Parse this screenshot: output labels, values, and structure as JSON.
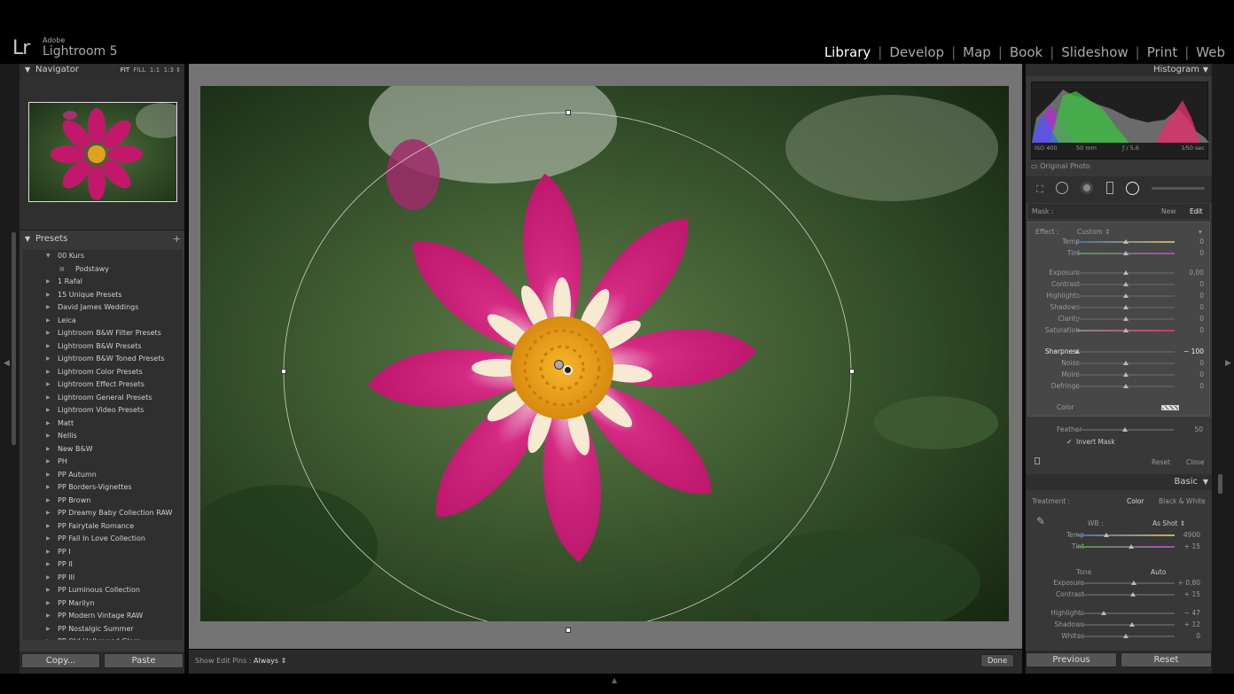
{
  "app": {
    "logo": "Lr",
    "vendor": "Adobe",
    "name": "Lightroom 5"
  },
  "modules": [
    "Library",
    "Develop",
    "Map",
    "Book",
    "Slideshow",
    "Print",
    "Web"
  ],
  "active_module": "Library",
  "navigator": {
    "title": "Navigator",
    "zoom": [
      "FIT",
      "FILL",
      "1:1",
      "1:3"
    ]
  },
  "presets": {
    "title": "Presets",
    "add": "+",
    "items": [
      {
        "label": "00 Kurs",
        "open": true
      },
      {
        "label": "Podstawy",
        "sub": true
      },
      {
        "label": "1 Rafal"
      },
      {
        "label": "15 Unique Presets"
      },
      {
        "label": "David James Weddings"
      },
      {
        "label": "Leica"
      },
      {
        "label": "Lightroom B&W Filter Presets"
      },
      {
        "label": "Lightroom B&W Presets"
      },
      {
        "label": "Lightroom B&W Toned Presets"
      },
      {
        "label": "Lightroom Color Presets"
      },
      {
        "label": "Lightroom Effect Presets"
      },
      {
        "label": "Lightroom General Presets"
      },
      {
        "label": "Lightroom Video Presets"
      },
      {
        "label": "Matt"
      },
      {
        "label": "Nellis"
      },
      {
        "label": "New B&W"
      },
      {
        "label": "PH"
      },
      {
        "label": "PP Autumn"
      },
      {
        "label": "PP Borders-Vignettes"
      },
      {
        "label": "PP Brown"
      },
      {
        "label": "PP Dreamy Baby Collection RAW"
      },
      {
        "label": "PP Fairytale Romance"
      },
      {
        "label": "PP Fall In Love Collection"
      },
      {
        "label": "PP I"
      },
      {
        "label": "PP II"
      },
      {
        "label": "PP III"
      },
      {
        "label": "PP Luminous Collection"
      },
      {
        "label": "PP Marilyn"
      },
      {
        "label": "PP Modern Vintage RAW"
      },
      {
        "label": "PP Nostalgic Summer"
      },
      {
        "label": "PP Old Hollywood Glam"
      }
    ]
  },
  "left_buttons": {
    "copy": "Copy...",
    "paste": "Paste"
  },
  "toolbar": {
    "edit_pins_label": "Show Edit Pins :",
    "edit_pins_value": "Always",
    "done": "Done"
  },
  "histogram": {
    "title": "Histogram",
    "iso": "ISO 400",
    "focal": "50 mm",
    "aperture": "ƒ / 5,6",
    "shutter": "1⁄50 sec",
    "original_photo": "Original Photo"
  },
  "mask": {
    "label": "Mask :",
    "new": "New",
    "edit": "Edit",
    "effect_label": "Effect :",
    "effect_value": "Custom",
    "sliders": [
      {
        "name": "Temp",
        "value": "0",
        "pos": 0.5
      },
      {
        "name": "Tint",
        "value": "0",
        "pos": 0.5
      },
      {
        "name": "Exposure",
        "value": "0,00",
        "pos": 0.5
      },
      {
        "name": "Contrast",
        "value": "0",
        "pos": 0.5
      },
      {
        "name": "Highlights",
        "value": "0",
        "pos": 0.5
      },
      {
        "name": "Shadows",
        "value": "0",
        "pos": 0.5
      },
      {
        "name": "Clarity",
        "value": "0",
        "pos": 0.5
      },
      {
        "name": "Saturation",
        "value": "0",
        "pos": 0.5
      },
      {
        "name": "Sharpness",
        "value": "− 100",
        "pos": 0.0
      },
      {
        "name": "Noise",
        "value": "0",
        "pos": 0.5
      },
      {
        "name": "Moiré",
        "value": "0",
        "pos": 0.5
      },
      {
        "name": "Defringe",
        "value": "0",
        "pos": 0.5
      }
    ],
    "color_label": "Color",
    "feather_label": "Feather",
    "feather_value": "50",
    "feather_pos": 0.5,
    "invert_label": "Invert Mask",
    "reset": "Reset",
    "close": "Close"
  },
  "basic": {
    "title": "Basic",
    "treatment_label": "Treatment :",
    "color": "Color",
    "bw": "Black & White",
    "wb_label": "WB :",
    "wb_value": "As Shot",
    "temp": {
      "name": "Temp",
      "value": "4900",
      "pos": 0.3
    },
    "tint": {
      "name": "Tint",
      "value": "+ 15",
      "pos": 0.55
    },
    "tone_label": "Tone",
    "auto": "Auto",
    "exposure": {
      "name": "Exposure",
      "value": "+ 0,80",
      "pos": 0.58
    },
    "contrast": {
      "name": "Contrast",
      "value": "+ 15",
      "pos": 0.57
    },
    "highlights": {
      "name": "Highlights",
      "value": "− 47",
      "pos": 0.27
    },
    "shadows": {
      "name": "Shadows",
      "value": "+ 12",
      "pos": 0.56
    },
    "whites": {
      "name": "Whites",
      "value": "0",
      "pos": 0.5
    }
  },
  "right_buttons": {
    "previous": "Previous",
    "reset": "Reset"
  }
}
